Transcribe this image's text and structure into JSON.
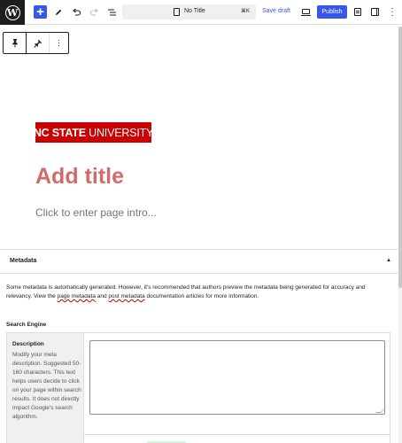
{
  "header": {
    "document_title": "No Title",
    "shortcut": "⌘K",
    "save_draft_label": "Save draft",
    "publish_label": "Publish"
  },
  "icons": {
    "add": "plus-icon",
    "edit": "pencil-icon",
    "undo": "undo-icon",
    "redo": "redo-icon",
    "list_view": "list-view-icon",
    "more": "more-vertical-icon"
  },
  "colors": {
    "accent": "#3858e9",
    "brand_red": "#cc0000",
    "title_placeholder": "#d46b6b"
  },
  "logo": {
    "bold": "NC STATE",
    "regular": " UNIVERSITY"
  },
  "content": {
    "title_placeholder": "Add title",
    "intro_placeholder": "Click to enter page intro..."
  },
  "metadata": {
    "header": "Metadata",
    "intro_part1": "Some metadata is automatically generated. However, it's recommended that authors preview the metadata being generated for accuracy and relevancy. View the ",
    "link1": "page metadata",
    "intro_part2": " and ",
    "link2": "post metadata",
    "intro_part3": " documentation articles for more information.",
    "search_engine": {
      "title": "Search Engine",
      "description_label": "Description",
      "description_help": "Modify your meta description. Suggested 50-160 characters. This text helps users decide to click on your page within search results. It does not directly impact Google's search algorithm.",
      "description_value": ""
    }
  }
}
